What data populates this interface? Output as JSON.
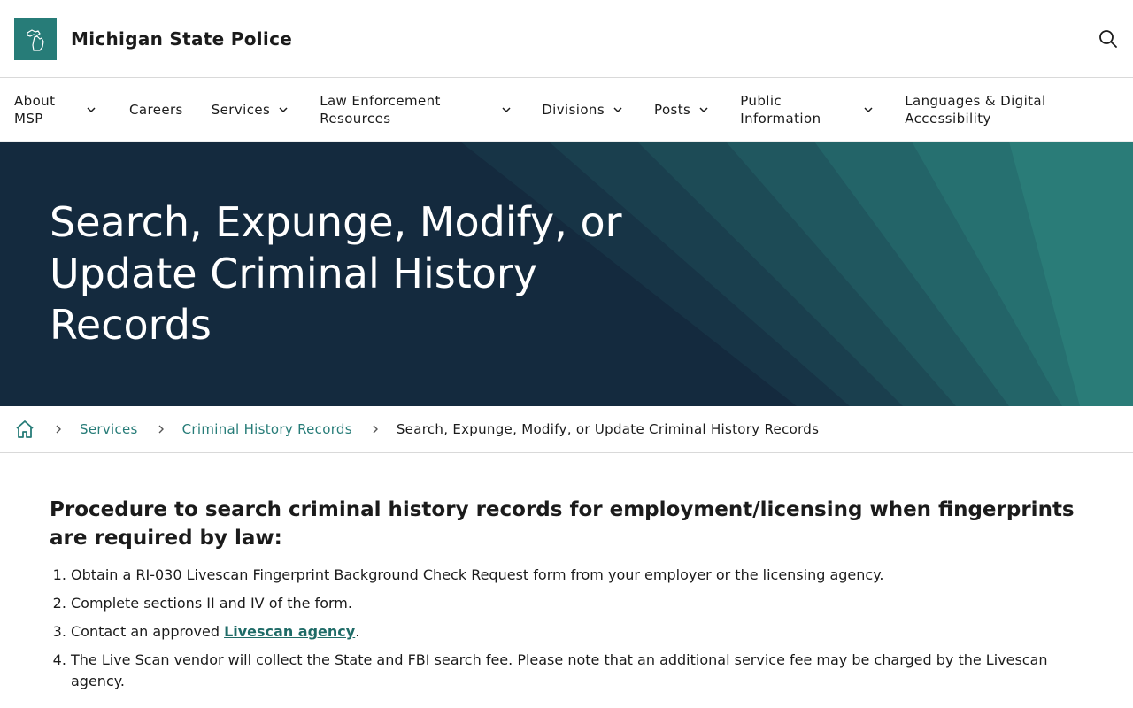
{
  "header": {
    "site_title": "Michigan State Police",
    "logo_icon": "michigan-map-icon",
    "search_icon": "search-icon"
  },
  "nav": {
    "about": "About MSP",
    "careers": "Careers",
    "services": "Services",
    "law_enforcement": "Law Enforcement Resources",
    "divisions": "Divisions",
    "posts": "Posts",
    "public_information": "Public Information",
    "languages": "Languages & Digital Accessibility"
  },
  "hero": {
    "title": "Search, Expunge, Modify, or Update Criminal History Records"
  },
  "breadcrumb": {
    "home_icon": "home-icon",
    "items": [
      "Services",
      "Criminal History Records"
    ],
    "current": "Search, Expunge, Modify, or Update Criminal History Records"
  },
  "content": {
    "heading": "Procedure to search criminal history records for employment/licensing when fingerprints are required by law:",
    "steps": [
      "Obtain a RI-030 Livescan Fingerprint Background Check Request form from your employer or the licensing agency.",
      "Complete sections II and IV of the form.",
      "The Live Scan vendor will collect the State and FBI search fee. Please note that an additional service fee may be charged by the Livescan agency."
    ],
    "step3_prefix": "Contact an approved ",
    "step3_link": "Livescan agency",
    "step3_suffix": "."
  },
  "colors": {
    "brand_teal": "#277c78",
    "hero_navy": "#142a3e",
    "link": "#277c78"
  }
}
